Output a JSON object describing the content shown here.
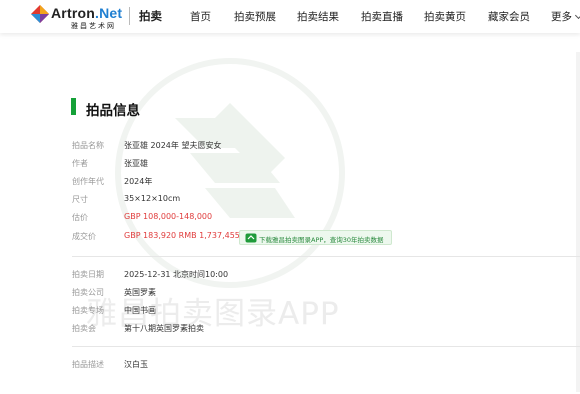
{
  "header": {
    "logo_word_main": "Artron",
    "logo_word_net": ".Net",
    "logo_sub": "雅昌艺术网",
    "section_name": "拍卖",
    "nav": [
      "首页",
      "拍卖预展",
      "拍卖结果",
      "拍卖直播",
      "拍卖黄页",
      "藏家会员",
      "更多"
    ]
  },
  "watermark": {
    "text": "雅昌拍卖图录APP"
  },
  "section": {
    "title": "拍品信息"
  },
  "details": [
    {
      "label": "拍品名称",
      "value": "张亚雄 2024年 望夫愿安女"
    },
    {
      "label": "作者",
      "value": "张亚雄"
    },
    {
      "label": "创作年代",
      "value": "2024年"
    },
    {
      "label": "尺寸",
      "value": "35×12×10cm"
    },
    {
      "label": "估价",
      "value": "GBP 108,000-148,000"
    },
    {
      "label": "成交价",
      "value": "GBP 183,920 RMB 1,737,455"
    }
  ],
  "app_button": {
    "label": "下载雅昌拍卖图录APP，查询30年拍卖数据"
  },
  "auction_info": [
    {
      "label": "拍卖日期",
      "value": "2025-12-31 北京时间10:00"
    },
    {
      "label": "拍卖公司",
      "value": "英国罗素"
    },
    {
      "label": "拍卖专场",
      "value": "中国书画"
    },
    {
      "label": "拍卖会",
      "value": "第十八期英国罗素拍卖"
    }
  ],
  "description": {
    "label": "拍品描述",
    "value": "汉白玉"
  },
  "colors": {
    "accent_green": "#15a138",
    "price_red": "#e03c3c",
    "brand_blue": "#1f7fd1"
  }
}
